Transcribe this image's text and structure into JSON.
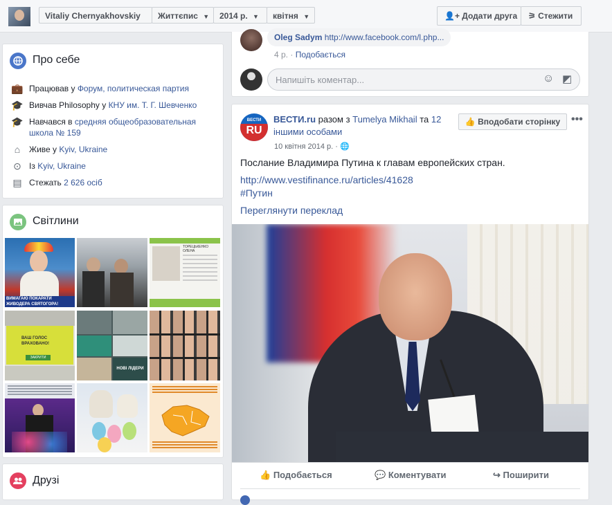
{
  "topbar": {
    "profile_name": "Vitaliy Chernyakhovskiy",
    "section": "Життєпис",
    "year": "2014 р.",
    "month": "квітня",
    "add_friend": "Додати друга",
    "follow": "Стежити"
  },
  "about": {
    "title": "Про себе",
    "work_prefix": "Працював у",
    "work_link": "Форум, политическая партия",
    "study_prefix": "Вивчав Philosophy у",
    "study_link": "КНУ им. Т. Г. Шевченко",
    "school_prefix": "Навчався в",
    "school_link": "средняя общеобразовательная школа № 159",
    "lives_prefix": "Живе у",
    "lives_link": "Kyiv, Ukraine",
    "from_prefix": "Із",
    "from_link": "Kyiv, Ukraine",
    "followers_prefix": "Стежать",
    "followers_link": "2 626 осіб"
  },
  "photos": {
    "title": "Світлини",
    "items": [
      {
        "caption": "ВИМАГАЮ ПОКАРАТИ ЖИВОДЕРА СВЯТОГОРА!"
      },
      {
        "caption": ""
      },
      {
        "caption": "ТОРЕЦЬКЕНКО ОЛЕНА"
      },
      {
        "caption": "ВАШ ГОЛОС ВРАХОВАНО!"
      },
      {
        "caption": "НОВІ ЛІДЕРИ"
      },
      {
        "caption": ""
      },
      {
        "caption": ""
      },
      {
        "caption": ""
      },
      {
        "caption": ""
      }
    ],
    "extra_btn": "ЗАКРИТИ"
  },
  "friends": {
    "title": "Друзі"
  },
  "comment": {
    "author": "Oleg Sadym",
    "text": "http://www.facebook.com/l.php...",
    "time": "4 р.",
    "like": "Подобається",
    "placeholder": "Напишіть коментар..."
  },
  "post": {
    "page_logo_top": "ВЕСТИ",
    "page_logo_bottom": "RU",
    "page_name": "ВЕСТИ.ru",
    "with_text": "разом з",
    "with_person": "Tumelya Mikhail",
    "and_text": "та",
    "others": "12 іншими особами",
    "date": "10 квітня 2014 р.",
    "like_page": "Вподобати сторінку",
    "text": "Послание Владимира Путина к главам европейских стран.",
    "url": "http://www.vestifinance.ru/articles/41628",
    "hashtag": "#Путин",
    "translate": "Переглянути переклад",
    "actions": {
      "like": "Подобається",
      "comment": "Коментувати",
      "share": "Поширити"
    }
  }
}
